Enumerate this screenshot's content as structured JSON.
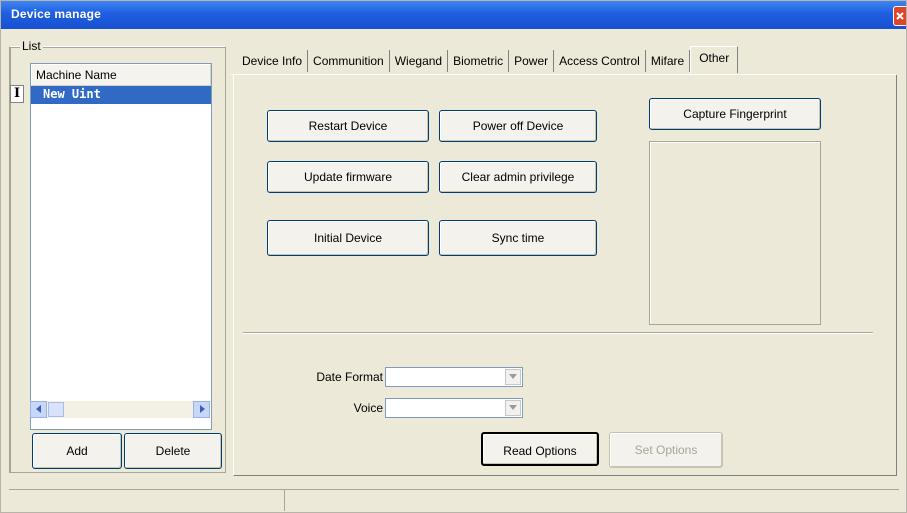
{
  "window": {
    "title": "Device manage"
  },
  "list": {
    "legend": "List",
    "column_header": "Machine Name",
    "row_marker": "I",
    "rows": [
      {
        "name": "New Uint"
      }
    ]
  },
  "list_buttons": {
    "add": "Add",
    "delete": "Delete"
  },
  "tabs": [
    "Device Info",
    "Communition",
    "Wiegand",
    "Biometric",
    "Power",
    "Access Control",
    "Mifare",
    "Other"
  ],
  "active_tab": "Other",
  "other_panel": {
    "restart": "Restart Device",
    "power_off": "Power off Device",
    "update_firmware": "Update firmware",
    "clear_admin": "Clear admin privilege",
    "initial": "Initial Device",
    "sync_time": "Sync time",
    "capture_fingerprint": "Capture Fingerprint",
    "date_format_label": "Date Format",
    "date_format_value": "",
    "voice_label": "Voice",
    "voice_value": "",
    "read_options": "Read Options",
    "set_options": "Set Options"
  },
  "icons": {
    "close": "close-icon",
    "scroll_left": "arrow-left-icon",
    "scroll_right": "arrow-right-icon",
    "dropdown": "chevron-down-icon"
  },
  "colors": {
    "titlebar": "#1f5ee0",
    "selection": "#316ac5",
    "face": "#ece9d8"
  }
}
